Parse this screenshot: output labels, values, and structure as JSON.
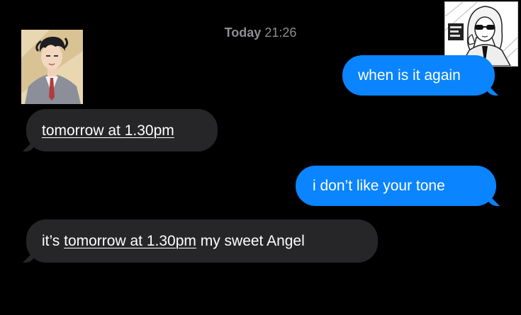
{
  "header": {
    "timestamp_day": "Today",
    "timestamp_time": "21:26"
  },
  "messages": [
    {
      "direction": "outgoing",
      "text": "when is it again"
    },
    {
      "direction": "incoming",
      "text": "tomorrow at 1.30pm"
    },
    {
      "direction": "outgoing",
      "text": "i don’t like your tone"
    },
    {
      "direction": "incoming",
      "prefix": "it’s ",
      "link": "tomorrow at 1.30pm",
      "suffix": " my sweet Angel"
    }
  ],
  "colors": {
    "background": "#000000",
    "incoming_bubble": "#262628",
    "outgoing_bubble": "#0a84ff",
    "timestamp": "#8e8e93"
  }
}
